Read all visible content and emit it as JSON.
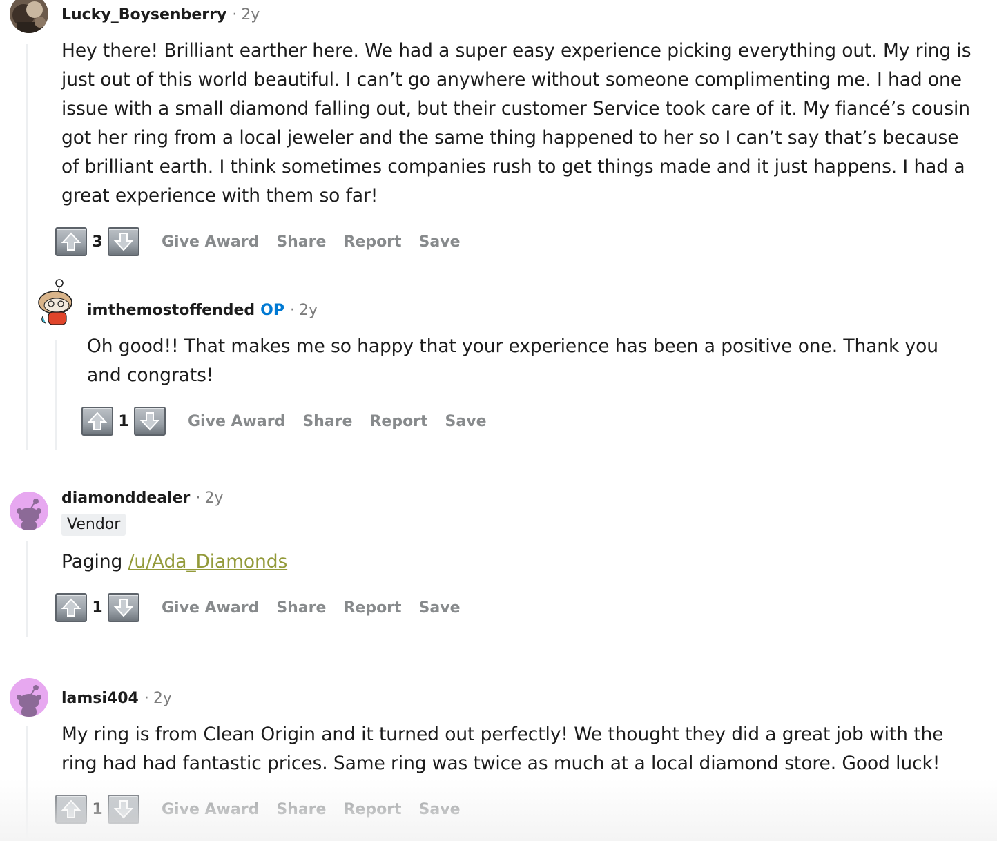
{
  "comments": [
    {
      "username": "Lucky_Boysenberry",
      "age": "2y",
      "body": "Hey there! Brilliant earther here. We had a super easy experience picking everything out. My ring is just out of this world beautiful. I can’t go anywhere without someone complimenting me. I had one issue with a small diamond falling out, but their customer Service took care of it. My fiancé’s cousin got her ring from a local jeweler and the same thing happened to her so I can’t say that’s because of brilliant earth. I think sometimes companies rush to get things made and it just happens. I had a great experience with them so far!",
      "score": "3",
      "avatar_icon": "user-photo-avatar"
    },
    {
      "username": "imthemostoffended",
      "op_label": "OP",
      "age": "2y",
      "body": "Oh good!! That makes me so happy that your experience has been a positive one. Thank you and congrats!",
      "score": "1",
      "avatar_icon": "snoo-custom-avatar"
    },
    {
      "username": "diamonddealer",
      "age": "2y",
      "flair": "Vendor",
      "body_prefix": "Paging ",
      "body_link": "/u/Ada_Diamonds",
      "score": "1",
      "avatar_icon": "snoo-default-avatar"
    },
    {
      "username": "lamsi404",
      "age": "2y",
      "body": "My ring is from Clean Origin and it turned out perfectly! We thought they did a great job with the ring had had fantastic prices. Same ring was twice as much at a local diamond store. Good luck!",
      "score": "1",
      "avatar_icon": "snoo-default-avatar"
    }
  ],
  "actions": {
    "give_award": "Give Award",
    "share": "Share",
    "report": "Report",
    "save": "Save"
  },
  "meta_separator": "·",
  "icons": {
    "upvote": "upvote-arrow-icon",
    "downvote": "downvote-arrow-icon"
  },
  "colors": {
    "op_tag": "#0079d3",
    "link": "#939a3a",
    "action_text": "#878a8c",
    "thread_line": "#edeff1",
    "avatar_bg": "#e7a8f0"
  }
}
